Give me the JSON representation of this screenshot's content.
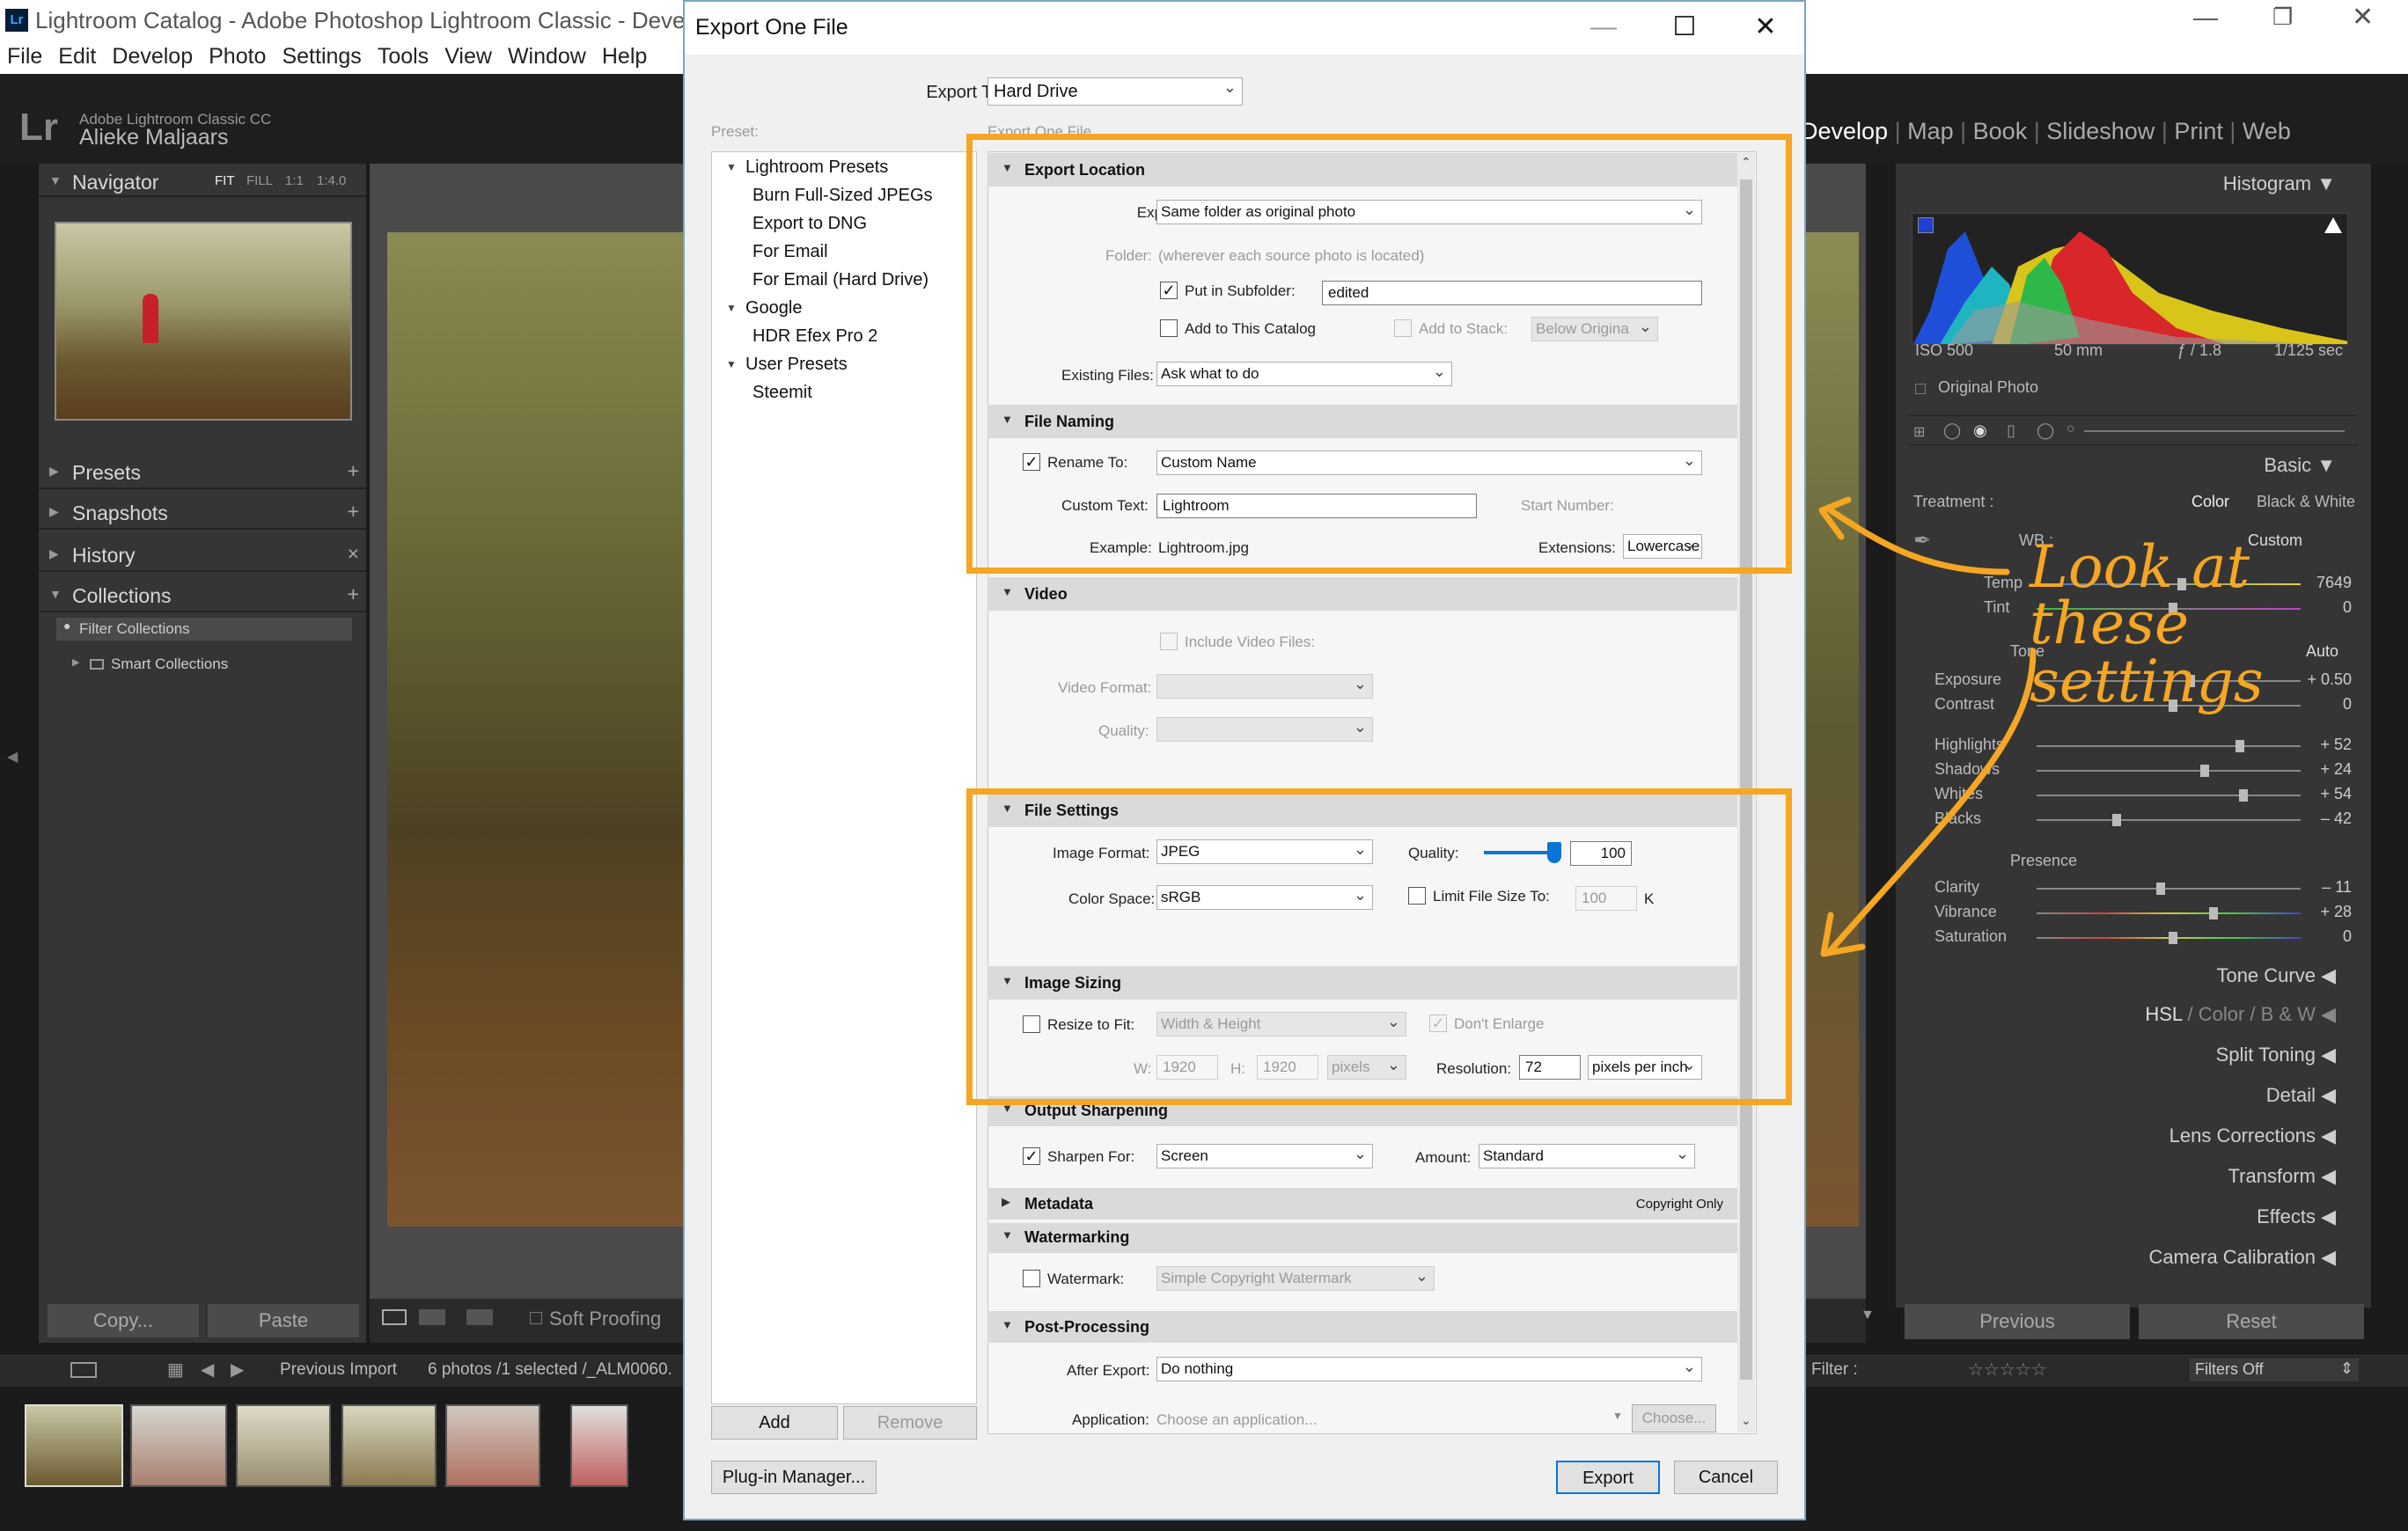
{
  "lightroom": {
    "window_title": "Lightroom Catalog - Adobe Photoshop Lightroom Classic - Develop",
    "menu": [
      "File",
      "Edit",
      "Develop",
      "Photo",
      "Settings",
      "Tools",
      "View",
      "Window",
      "Help"
    ],
    "identity_line1": "Adobe Lightroom Classic CC",
    "identity_line2": "Alieke Maljaars",
    "logo": "Lr",
    "modules": [
      "Develop",
      "Map",
      "Book",
      "Slideshow",
      "Print",
      "Web"
    ],
    "left_panels": {
      "navigator": "Navigator",
      "nav_zoom": [
        "FIT",
        "FILL",
        "1:1",
        "1:4.0"
      ],
      "presets": "Presets",
      "snapshots": "Snapshots",
      "history": "History",
      "collections": "Collections",
      "filter_collections": "Filter Collections",
      "smart_collections": "Smart Collections",
      "copy": "Copy...",
      "paste": "Paste"
    },
    "toolbar": {
      "soft_proofing": "Soft Proofing"
    },
    "right_panels": {
      "histogram": "Histogram",
      "iso": "ISO 500",
      "focal": "50 mm",
      "aperture": "ƒ / 1.8",
      "shutter": "1/125 sec",
      "original_photo": "Original Photo",
      "basic": "Basic",
      "treatment": "Treatment :",
      "color": "Color",
      "bw": "Black & White",
      "wb": "WB :",
      "wb_value": "Custom",
      "temp": "Temp",
      "temp_val": "7649",
      "tint": "Tint",
      "tint_val": "0",
      "tone": "Tone",
      "auto": "Auto",
      "exposure": "Exposure",
      "exposure_val": "+ 0.50",
      "contrast": "Contrast",
      "contrast_val": "0",
      "highlights": "Highlights",
      "highlights_val": "+ 52",
      "shadows": "Shadows",
      "shadows_val": "+ 24",
      "whites": "Whites",
      "whites_val": "+ 54",
      "blacks": "Blacks",
      "blacks_val": "– 42",
      "presence": "Presence",
      "clarity": "Clarity",
      "clarity_val": "– 11",
      "vibrance": "Vibrance",
      "vibrance_val": "+ 28",
      "saturation": "Saturation",
      "saturation_val": "0",
      "tone_curve": "Tone Curve",
      "hsl": "HSL",
      "hsl_color": "Color",
      "hsl_bw": "B & W",
      "split_toning": "Split Toning",
      "detail": "Detail",
      "lens_corrections": "Lens Corrections",
      "transform": "Transform",
      "effects": "Effects",
      "camera_calibration": "Camera Calibration",
      "previous": "Previous",
      "reset": "Reset"
    },
    "filmstrip": {
      "source": "Previous Import",
      "count": "6 photos /1 selected /_ALM0060.",
      "filter": "Filter :",
      "filters_off": "Filters Off"
    }
  },
  "dialog": {
    "title": "Export One File",
    "export_to_label": "Export To:",
    "export_to_value": "Hard Drive",
    "preset_label": "Preset:",
    "header_ghost": "Export One File",
    "presets_tree": [
      {
        "label": "Lightroom Presets",
        "children": [
          "Burn Full-Sized JPEGs",
          "Export to DNG",
          "For Email",
          "For Email (Hard Drive)"
        ]
      },
      {
        "label": "Google",
        "children": [
          "HDR Efex Pro 2"
        ]
      },
      {
        "label": "User Presets",
        "children": [
          "Steemit"
        ]
      }
    ],
    "add": "Add",
    "remove": "Remove",
    "plugin_manager": "Plug-in Manager...",
    "export": "Export",
    "cancel": "Cancel",
    "export_location": {
      "title": "Export Location",
      "export_to_label": "Export To:",
      "export_to_value": "Same folder as original photo",
      "folder_label": "Folder:",
      "folder_value": "(wherever each source photo is located)",
      "subfolder_label": "Put in Subfolder:",
      "subfolder_value": "edited",
      "add_catalog": "Add to This Catalog",
      "add_stack": "Add to Stack:",
      "stack_value": "Below Origina",
      "existing_label": "Existing Files:",
      "existing_value": "Ask what to do"
    },
    "file_naming": {
      "title": "File Naming",
      "rename_label": "Rename To:",
      "rename_value": "Custom Name",
      "custom_text_label": "Custom Text:",
      "custom_text_value": "Lightroom",
      "start_number": "Start Number:",
      "example_label": "Example:",
      "example_value": "Lightroom.jpg",
      "extensions_label": "Extensions:",
      "extensions_value": "Lowercase"
    },
    "video": {
      "title": "Video",
      "include": "Include Video Files:",
      "format_label": "Video Format:",
      "quality_label": "Quality:"
    },
    "file_settings": {
      "title": "File Settings",
      "format_label": "Image Format:",
      "format_value": "JPEG",
      "quality_label": "Quality:",
      "quality_value": "100",
      "quality_level": 1.0,
      "color_space_label": "Color Space:",
      "color_space_value": "sRGB",
      "limit_label": "Limit File Size To:",
      "limit_value": "100",
      "limit_unit": "K"
    },
    "image_sizing": {
      "title": "Image Sizing",
      "resize_label": "Resize to Fit:",
      "resize_value": "Width & Height",
      "dont_enlarge": "Don't Enlarge",
      "w_label": "W:",
      "w_value": "1920",
      "h_label": "H:",
      "h_value": "1920",
      "unit_value": "pixels",
      "resolution_label": "Resolution:",
      "resolution_value": "72",
      "resolution_unit": "pixels per inch"
    },
    "output_sharpening": {
      "title": "Output Sharpening",
      "sharpen_label": "Sharpen For:",
      "sharpen_value": "Screen",
      "amount_label": "Amount:",
      "amount_value": "Standard"
    },
    "metadata": {
      "title": "Metadata",
      "summary": "Copyright Only"
    },
    "watermarking": {
      "title": "Watermarking",
      "label": "Watermark:",
      "value": "Simple Copyright Watermark"
    },
    "post_processing": {
      "title": "Post-Processing",
      "after_label": "After Export:",
      "after_value": "Do nothing",
      "app_label": "Application:",
      "app_value": "Choose an application...",
      "choose": "Choose..."
    }
  },
  "annotation": {
    "line1": "Look at",
    "line2": "these settings",
    "color": "#f5a623"
  }
}
